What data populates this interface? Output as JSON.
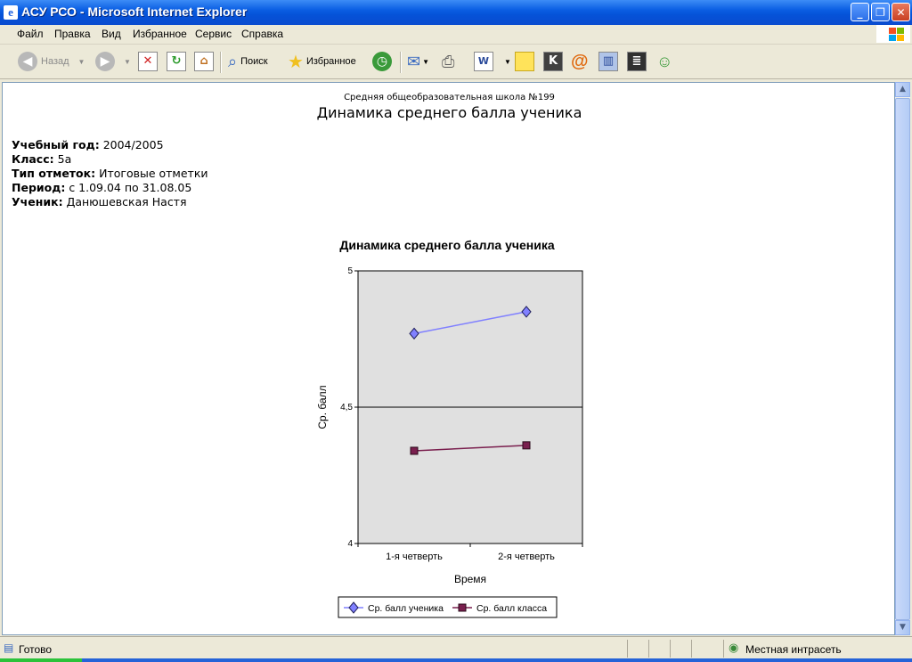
{
  "window": {
    "title": "АСУ РСО - Microsoft Internet Explorer"
  },
  "menu": [
    "Файл",
    "Правка",
    "Вид",
    "Избранное",
    "Сервис",
    "Справка"
  ],
  "toolbar": {
    "back": "Назад",
    "search": "Поиск",
    "favorites": "Избранное"
  },
  "report": {
    "school": "Средняя общеобразовательная школа №199",
    "title": "Динамика среднего балла ученика",
    "fields": [
      {
        "label": "Учебный год:",
        "value": "2004/2005"
      },
      {
        "label": "Класс:",
        "value": "5а"
      },
      {
        "label": "Тип отметок:",
        "value": "Итоговые отметки"
      },
      {
        "label": "Период:",
        "value": "с 1.09.04 по 31.08.05"
      },
      {
        "label": "Ученик:",
        "value": "Данюшевская Настя"
      }
    ]
  },
  "chart_data": {
    "type": "line",
    "title": "Динамика среднего балла ученика",
    "xlabel": "Время",
    "ylabel": "Ср. балл",
    "categories": [
      "1-я четверть",
      "2-я четверть"
    ],
    "ylim": [
      4,
      5
    ],
    "yticks": [
      "4",
      "4,5",
      "5"
    ],
    "series": [
      {
        "name": "Ср. балл ученика",
        "values": [
          4.77,
          4.85
        ],
        "color": "#8080ff",
        "marker": "diamond"
      },
      {
        "name": "Ср. балл класса",
        "values": [
          4.34,
          4.36
        ],
        "color": "#7a1f4e",
        "marker": "square"
      }
    ],
    "plot_background": "#e0e0e0",
    "legend_position": "bottom"
  },
  "status": {
    "text": "Готово",
    "zone": "Местная интрасеть"
  }
}
